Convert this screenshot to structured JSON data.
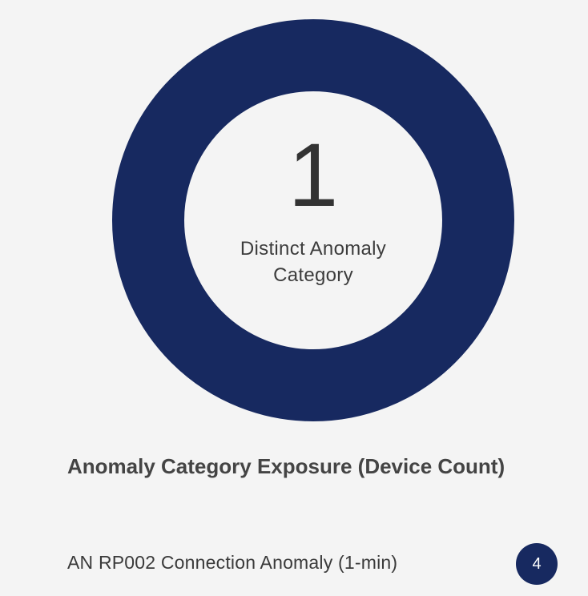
{
  "colors": {
    "background": "#f4f4f4",
    "ring": "#172960",
    "badge": "#172960"
  },
  "chart_data": {
    "type": "pie",
    "variant": "donut",
    "title": "Anomaly Category Exposure (Device Count)",
    "categories": [
      "AN RP002 Connection Anomaly (1-min)"
    ],
    "values": [
      4
    ],
    "center_value": "1",
    "center_label": "Distinct Anomaly Category"
  },
  "categories_list": [
    {
      "label": "AN RP002 Connection Anomaly (1-min)",
      "count": "4"
    }
  ]
}
